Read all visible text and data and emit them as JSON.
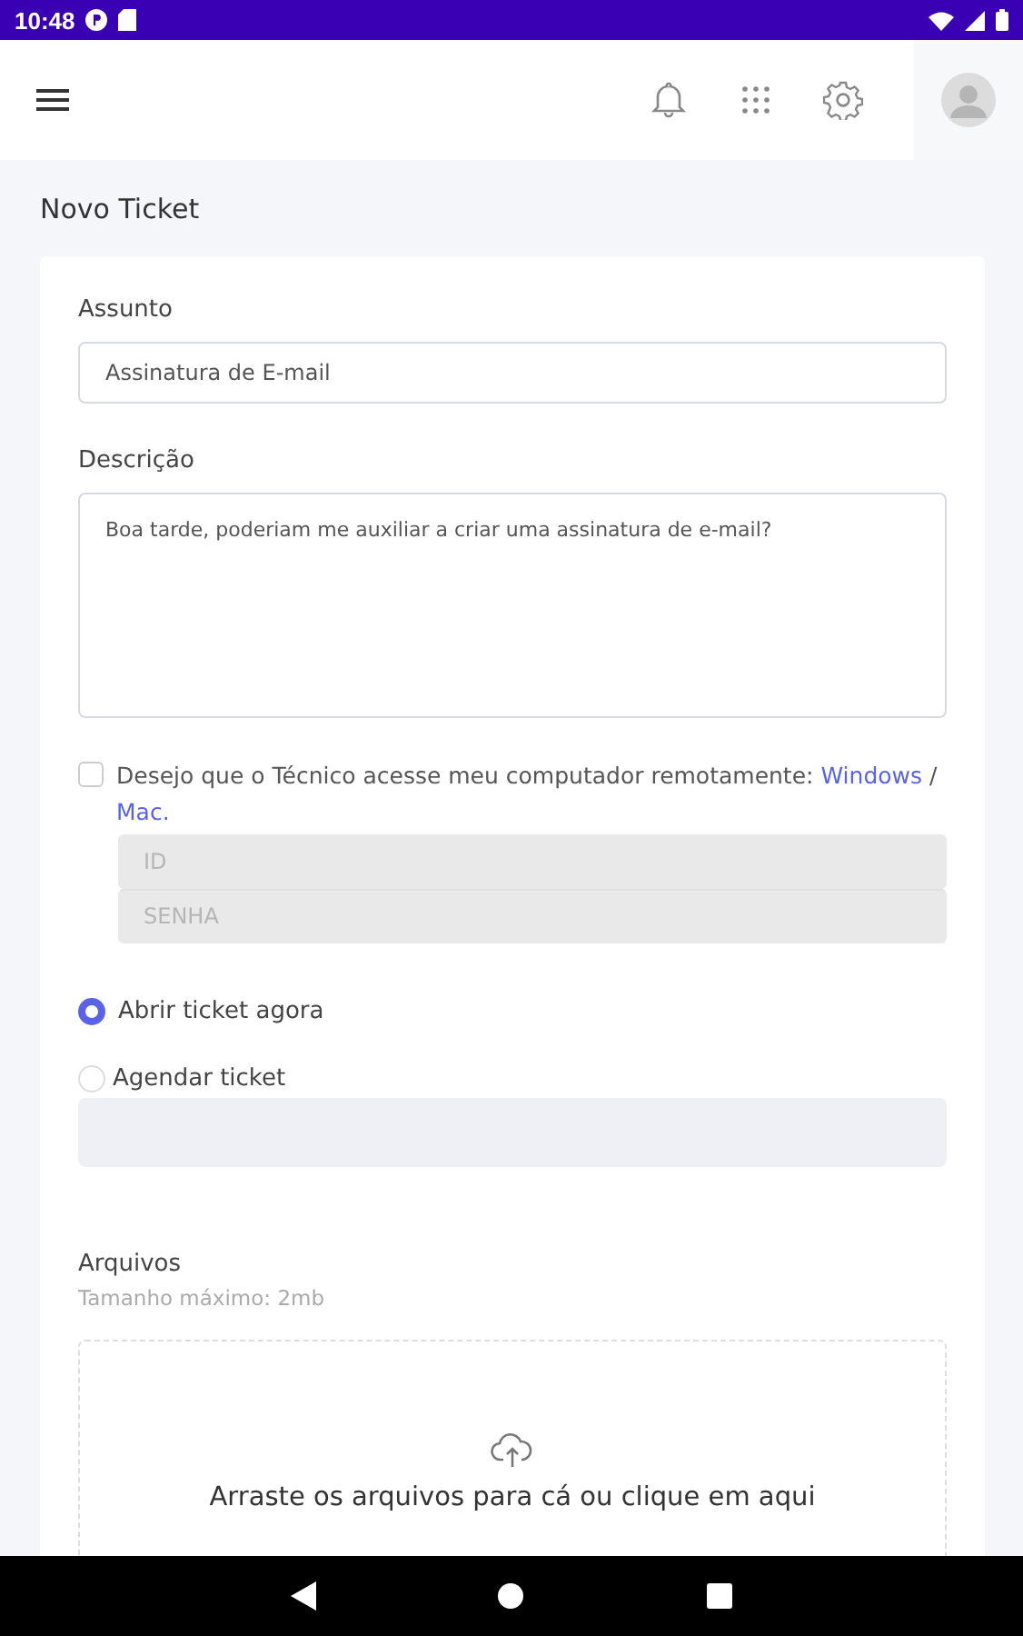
{
  "status_bar": {
    "time": "10:48"
  },
  "page": {
    "title": "Novo Ticket"
  },
  "form": {
    "subject": {
      "label": "Assunto",
      "value": "Assinatura de E-mail"
    },
    "description": {
      "label": "Descrição",
      "value": "Boa tarde, poderiam me auxiliar a criar uma assinatura de e-mail?"
    },
    "remote": {
      "checked": false,
      "text": "Desejo que o Técnico acesse meu computador remotamente:",
      "links": [
        {
          "label": "Windows"
        },
        {
          "label": "Mac."
        }
      ],
      "separator": "/",
      "fields": [
        {
          "placeholder": "ID",
          "disabled": true
        },
        {
          "placeholder": "SENHA",
          "disabled": true
        }
      ]
    },
    "options": [
      {
        "label": "Abrir ticket agora",
        "selected": true
      },
      {
        "label": "Agendar ticket",
        "selected": false
      }
    ],
    "files": {
      "label": "Arquivos",
      "hint": "Tamanho máximo: 2mb",
      "dropzone": "Arraste os arquivos para cá ou clique em aqui"
    }
  }
}
